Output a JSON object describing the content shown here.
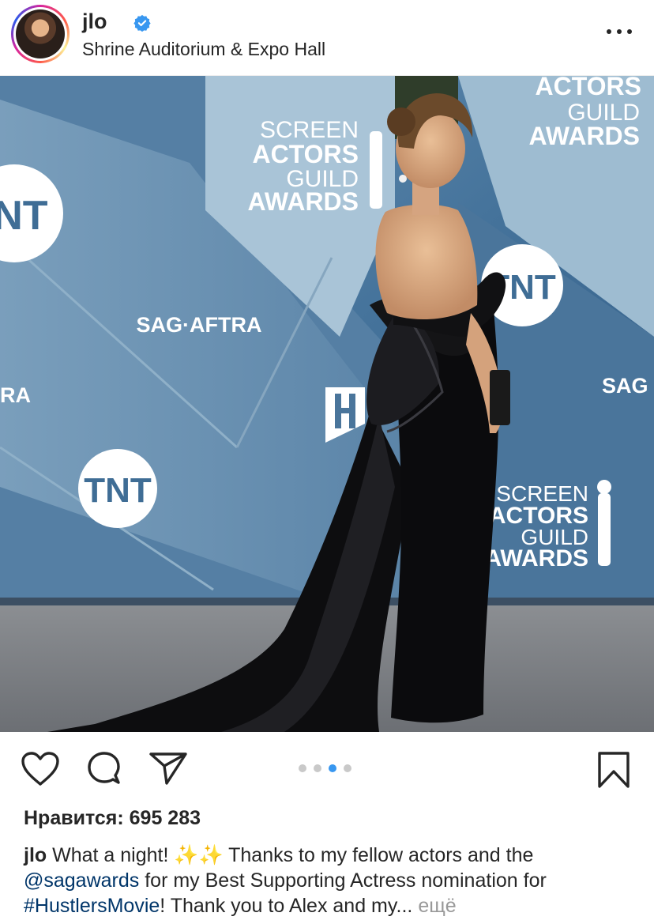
{
  "post": {
    "username": "jlo",
    "verified": true,
    "location": "Shrine Auditorium & Expo Hall"
  },
  "photo": {
    "backdrop_texts": {
      "tnt": "TNT",
      "sag_aftra": "SAG·AFTRA",
      "sag_partial": "SAG",
      "ra_partial": "RA",
      "screen": "SCREEN",
      "actors": "ACTORS",
      "guild": "GUILD",
      "awards": "AWARDS"
    }
  },
  "carousel": {
    "count": 4,
    "active_index": 2
  },
  "likes_text": "Нравится: 695 283",
  "caption": {
    "username": "jlo",
    "text_1": " What a night! ✨✨ Thanks to my fellow actors and the ",
    "mention": "@sagawards",
    "text_2": " for my Best Supporting Actress nomination for ",
    "hashtag": "#HustlersMovie",
    "text_3": "! Thank you to Alex and my... ",
    "more_label": "ещё"
  },
  "icons": {
    "like": "heart-icon",
    "comment": "comment-icon",
    "share": "send-icon",
    "save": "bookmark-icon"
  },
  "colors": {
    "link": "#003569",
    "active_dot": "#3897f0",
    "verified": "#3897f0"
  }
}
